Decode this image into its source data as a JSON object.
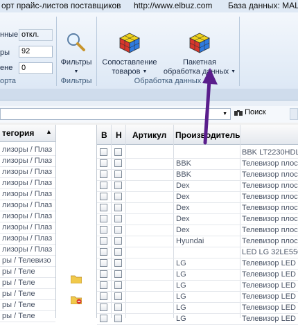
{
  "window": {
    "title_fragment_1": "орт прайс-листов поставщиков",
    "title_fragment_2": "http://www.elbuz.com",
    "title_fragment_3": "База данных: MAL"
  },
  "ribbon": {
    "import_group": {
      "label": "орта",
      "rows": [
        {
          "label": "нные",
          "column_header": "откл."
        },
        {
          "label": "ры",
          "value": "92"
        },
        {
          "label": "ене",
          "value": "0"
        }
      ]
    },
    "filters_group": {
      "label": "Фильтры",
      "button_label": "Фильтры",
      "icon": "magnifier-icon"
    },
    "data_processing_group": {
      "label": "Обработка данных",
      "compare_button": {
        "line1": "Сопоставление",
        "line2": "товаров",
        "icon": "rubik-cube-icon"
      },
      "batch_button": {
        "line1": "Пакетная",
        "line2": "обработка данных",
        "icon": "rubik-cube-icon"
      }
    },
    "annotation": {
      "color": "#5a1e8c",
      "target": "batch-processing-button"
    }
  },
  "toolbar": {
    "search_label": "Поиск",
    "search_icon": "binoculars-icon"
  },
  "category_grid": {
    "header": "тегория",
    "rows": [
      "лизоры / Плаз",
      "лизоры / Плаз",
      "лизоры / Плаз",
      "лизоры / Плаз",
      "лизоры / Плаз",
      "лизоры / Плаз",
      "лизоры / Плаз",
      "лизоры / Плаз",
      "лизоры / Плаз",
      "лизоры / Плаз",
      "ры / Телевизо",
      "ры / Теле",
      "ры / Теле",
      "ры / Теле",
      "ры / Теле",
      "ры / Теле"
    ],
    "folder_icons": [
      {
        "row": 11,
        "icon": "folder-icon"
      },
      {
        "row": 13,
        "icon": "folder-delete-icon"
      }
    ]
  },
  "products_grid": {
    "columns": [
      "В",
      "Н",
      "Артикул",
      "Производитель"
    ],
    "rows": [
      {
        "manufacturer": "",
        "name": "BBK LT2230HDL"
      },
      {
        "manufacturer": "BBK",
        "name": "Телевизор плос"
      },
      {
        "manufacturer": "BBK",
        "name": "Телевизор плос"
      },
      {
        "manufacturer": "Dex",
        "name": "Телевизор плос"
      },
      {
        "manufacturer": "Dex",
        "name": "Телевизор плос"
      },
      {
        "manufacturer": "Dex",
        "name": "Телевизор плос"
      },
      {
        "manufacturer": "Dex",
        "name": "Телевизор плос"
      },
      {
        "manufacturer": "Dex",
        "name": "Телевизор плос"
      },
      {
        "manufacturer": "Hyundai",
        "name": "Телевизор плос"
      },
      {
        "manufacturer": "",
        "name": "LED LG 32LE5500"
      },
      {
        "manufacturer": "LG",
        "name": "Телевизор LED L"
      },
      {
        "manufacturer": "LG",
        "name": "Телевизор LED L"
      },
      {
        "manufacturer": "LG",
        "name": "Телевизор LED L"
      },
      {
        "manufacturer": "LG",
        "name": "Телевизор LED L"
      },
      {
        "manufacturer": "LG",
        "name": "Телевизор LED L"
      },
      {
        "manufacturer": "LG",
        "name": "Телевизор LED L"
      }
    ]
  }
}
